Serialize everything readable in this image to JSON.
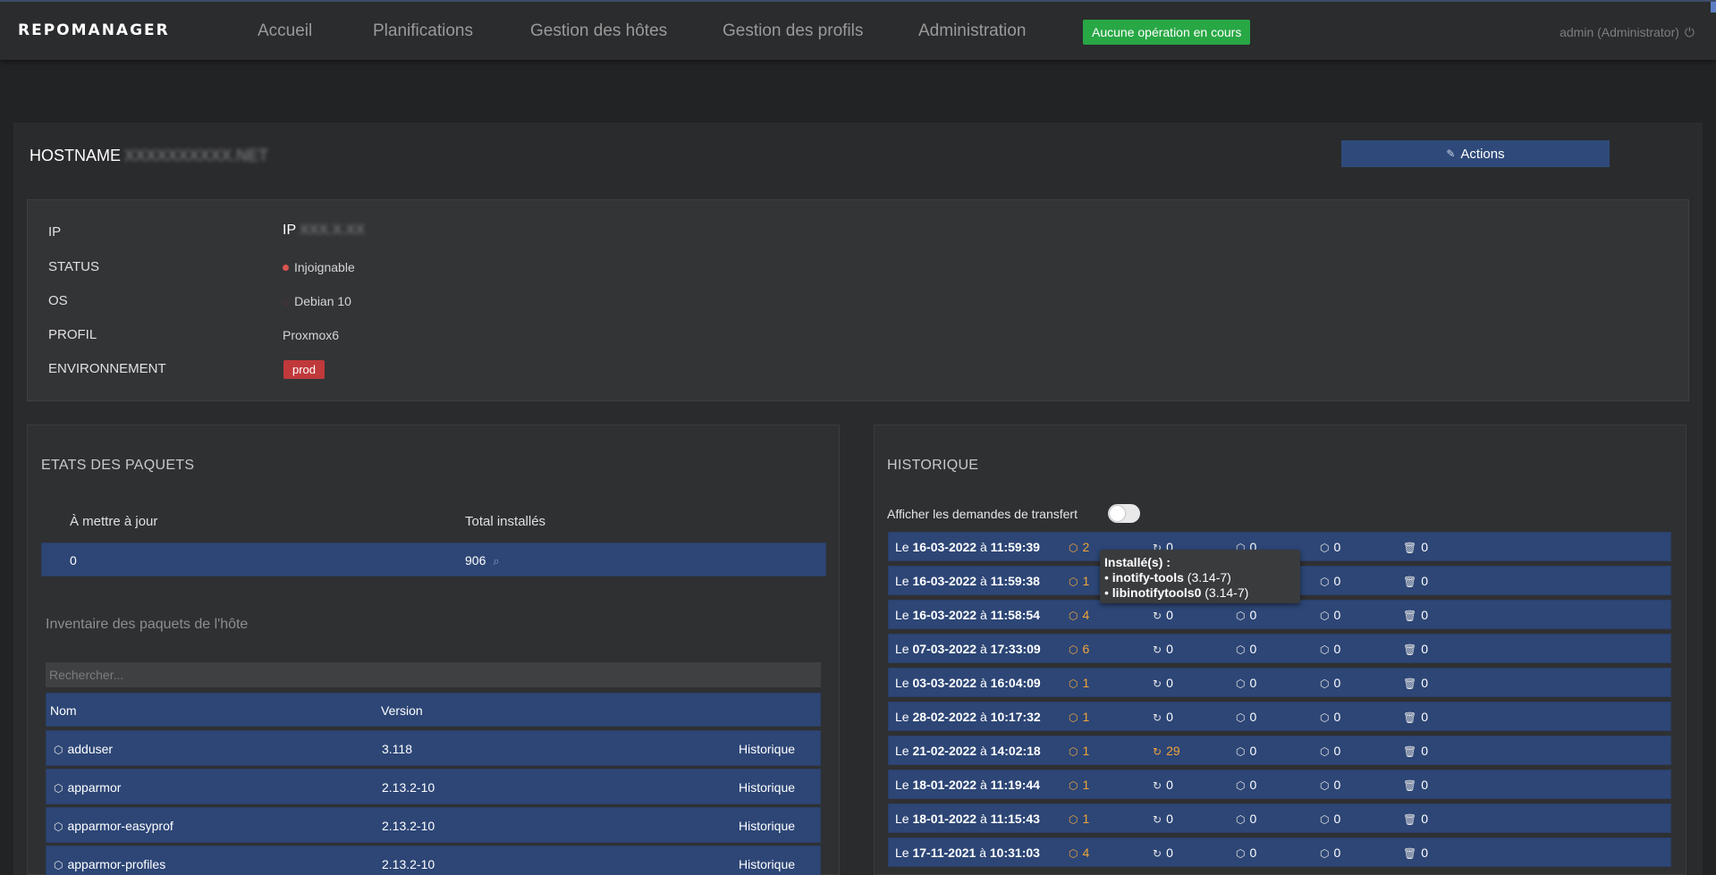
{
  "app": {
    "logo": "REPOMANAGER"
  },
  "nav": [
    {
      "label": "Accueil"
    },
    {
      "label": "Planifications"
    },
    {
      "label": "Gestion des hôtes"
    },
    {
      "label": "Gestion des profils"
    },
    {
      "label": "Administration"
    }
  ],
  "operation_status": "Aucune opération en cours",
  "user": {
    "label": "admin (Administrator)",
    "logout_icon": "power-icon"
  },
  "host": {
    "hostname_label": "HOSTNAME",
    "hostname_value": "XXXXXXXXXX.NET",
    "actions_label": "Actions",
    "actions_icon": "pencil-icon",
    "fields": {
      "ip_label": "IP",
      "ip_prefix": "IP",
      "ip_value": "XXX.X.XX",
      "status_label": "STATUS",
      "status_value": "Injoignable",
      "os_label": "OS",
      "os_value": "Debian 10",
      "profile_label": "PROFIL",
      "profile_value": "Proxmox6",
      "env_label": "ENVIRONNEMENT",
      "env_value": "prod"
    }
  },
  "packages": {
    "title": "ETATS DES PAQUETS",
    "to_update_label": "À mettre à jour",
    "total_label": "Total installés",
    "to_update_value": "0",
    "total_value": "906",
    "inventory_title": "Inventaire des paquets de l'hôte",
    "search_placeholder": "Rechercher...",
    "col_name": "Nom",
    "col_version": "Version",
    "rows": [
      {
        "name": "adduser",
        "version": "3.118",
        "action": "Historique"
      },
      {
        "name": "apparmor",
        "version": "2.13.2-10",
        "action": "Historique"
      },
      {
        "name": "apparmor-easyprof",
        "version": "2.13.2-10",
        "action": "Historique"
      },
      {
        "name": "apparmor-profiles",
        "version": "2.13.2-10",
        "action": "Historique"
      }
    ]
  },
  "history": {
    "title": "HISTORIQUE",
    "toggle_label": "Afficher les demandes de transfert",
    "toggle_on": false,
    "rows": [
      {
        "prefix": "Le",
        "date": "16-03-2022",
        "sep": "à",
        "time": "11:59:39",
        "installed": "2",
        "updated": "0",
        "downgraded": "0",
        "removed": "0",
        "purged": "0"
      },
      {
        "prefix": "Le",
        "date": "16-03-2022",
        "sep": "à",
        "time": "11:59:38",
        "installed": "1",
        "updated": "0",
        "downgraded": "0",
        "removed": "0",
        "purged": "0"
      },
      {
        "prefix": "Le",
        "date": "16-03-2022",
        "sep": "à",
        "time": "11:58:54",
        "installed": "4",
        "updated": "0",
        "downgraded": "0",
        "removed": "0",
        "purged": "0"
      },
      {
        "prefix": "Le",
        "date": "07-03-2022",
        "sep": "à",
        "time": "17:33:09",
        "installed": "6",
        "updated": "0",
        "downgraded": "0",
        "removed": "0",
        "purged": "0"
      },
      {
        "prefix": "Le",
        "date": "03-03-2022",
        "sep": "à",
        "time": "16:04:09",
        "installed": "1",
        "updated": "0",
        "downgraded": "0",
        "removed": "0",
        "purged": "0"
      },
      {
        "prefix": "Le",
        "date": "28-02-2022",
        "sep": "à",
        "time": "10:17:32",
        "installed": "1",
        "updated": "0",
        "downgraded": "0",
        "removed": "0",
        "purged": "0"
      },
      {
        "prefix": "Le",
        "date": "21-02-2022",
        "sep": "à",
        "time": "14:02:18",
        "installed": "1",
        "updated": "29",
        "downgraded": "0",
        "removed": "0",
        "purged": "0"
      },
      {
        "prefix": "Le",
        "date": "18-01-2022",
        "sep": "à",
        "time": "11:19:44",
        "installed": "1",
        "updated": "0",
        "downgraded": "0",
        "removed": "0",
        "purged": "0"
      },
      {
        "prefix": "Le",
        "date": "18-01-2022",
        "sep": "à",
        "time": "11:15:43",
        "installed": "1",
        "updated": "0",
        "downgraded": "0",
        "removed": "0",
        "purged": "0"
      },
      {
        "prefix": "Le",
        "date": "17-11-2021",
        "sep": "à",
        "time": "10:31:03",
        "installed": "4",
        "updated": "0",
        "downgraded": "0",
        "removed": "0",
        "purged": "0"
      }
    ],
    "tooltip": {
      "title": "Installé(s) :",
      "items": [
        {
          "name": "inotify-tools",
          "version": "(3.14-7)"
        },
        {
          "name": "libinotifytools0",
          "version": "(3.14-7)"
        }
      ]
    }
  },
  "colors": {
    "accent_row": "#2d4676",
    "orange": "#f0a43a",
    "status_red": "#d9534f",
    "ok_green": "#28a745"
  }
}
